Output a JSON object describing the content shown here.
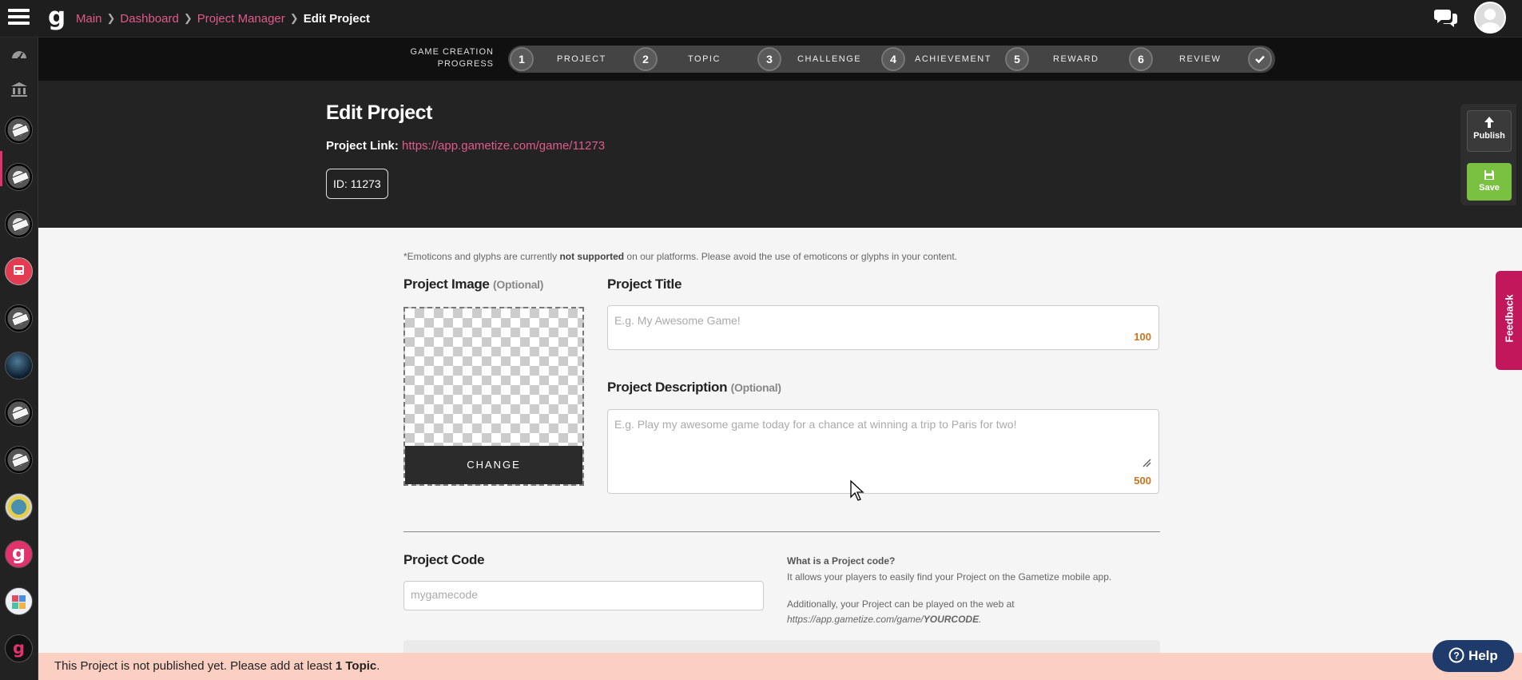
{
  "topbar": {
    "logo_letter": "g",
    "breadcrumb": {
      "items": [
        "Main",
        "Dashboard",
        "Project Manager"
      ],
      "current": "Edit Project"
    }
  },
  "progress": {
    "label_line1": "GAME CREATION",
    "label_line2": "PROGRESS",
    "steps": [
      {
        "number": "1",
        "label": "PROJECT"
      },
      {
        "number": "2",
        "label": "TOPIC"
      },
      {
        "number": "3",
        "label": "CHALLENGE"
      },
      {
        "number": "4",
        "label": "ACHIEVEMENT"
      },
      {
        "number": "5",
        "label": "REWARD"
      },
      {
        "number": "6",
        "label": "REVIEW"
      }
    ]
  },
  "header": {
    "title": "Edit Project",
    "link_label": "Project Link:",
    "link_url": "https://app.gametize.com/game/11273",
    "id_text": "ID: 11273"
  },
  "actions": {
    "publish_label": "Publish",
    "save_label": "Save"
  },
  "form": {
    "notice_pre": "*Emoticons and glyphs are currently ",
    "notice_bold": "not supported",
    "notice_post": " on our platforms. Please avoid the use of emoticons or glyphs in your content.",
    "image_label": "Project Image",
    "optional": "(Optional)",
    "change_label": "CHANGE",
    "title_label": "Project Title",
    "title_placeholder": "E.g. My Awesome Game!",
    "title_counter": "100",
    "desc_label": "Project Description",
    "desc_placeholder": "E.g. Play my awesome game today for a chance at winning a trip to Paris for two!",
    "desc_counter": "500",
    "code_label": "Project Code",
    "code_placeholder": "mygamecode",
    "code_help_q": "What is a Project code?",
    "code_help_1": "It allows your players to easily find your Project on the Gametize mobile app.",
    "code_help_2": "Additionally, your Project can be played on the web at",
    "code_help_url_prefix": "https://app.gametize.com/game/",
    "code_help_url_code": "YOURCODE",
    "code_help_url_suffix": "."
  },
  "feedback_label": "Feedback",
  "notification": {
    "pre": "This Project is not published yet. Please add at least ",
    "bold": "1 Topic",
    "post": "."
  },
  "help_label": "Help",
  "sidebar": {
    "logo_badge": "g"
  }
}
